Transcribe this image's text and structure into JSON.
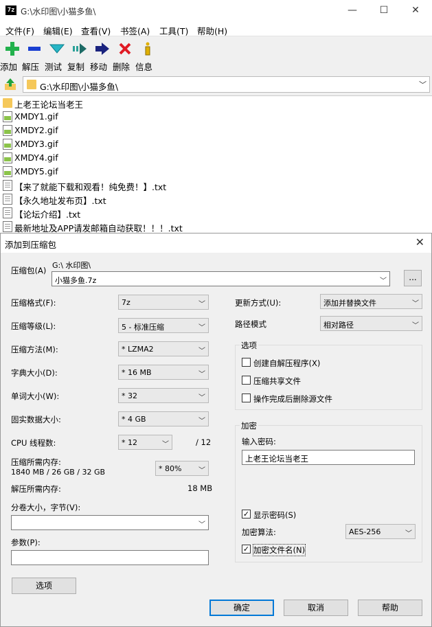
{
  "window": {
    "title": "G:\\水印图\\小猫多鱼\\",
    "app_icon_text": "7z",
    "minimize": "—",
    "maximize": "☐",
    "close": "✕"
  },
  "menu": [
    "文件(F)",
    "编辑(E)",
    "查看(V)",
    "书签(A)",
    "工具(T)",
    "帮助(H)"
  ],
  "toolbar": [
    {
      "label": "添加",
      "icon": "add-icon",
      "color": "#22b14c"
    },
    {
      "label": "解压",
      "icon": "extract-icon",
      "color": "#1a3fd1"
    },
    {
      "label": "测试",
      "icon": "test-icon",
      "color": "#27b6c6"
    },
    {
      "label": "复制",
      "icon": "copy-icon",
      "color": "#2aa198"
    },
    {
      "label": "移动",
      "icon": "move-icon",
      "color": "#1a237e"
    },
    {
      "label": "删除",
      "icon": "delete-icon",
      "color": "#e01b24"
    },
    {
      "label": "信息",
      "icon": "info-icon",
      "color": "#e0b000"
    }
  ],
  "address": {
    "path": "G:\\水印图\\小猫多鱼\\"
  },
  "files": [
    {
      "name": "上老王论坛当老王",
      "type": "folder"
    },
    {
      "name": "XMDY1.gif",
      "type": "gif"
    },
    {
      "name": "XMDY2.gif",
      "type": "gif"
    },
    {
      "name": "XMDY3.gif",
      "type": "gif"
    },
    {
      "name": "XMDY4.gif",
      "type": "gif"
    },
    {
      "name": "XMDY5.gif",
      "type": "gif"
    },
    {
      "name": "【来了就能下载和观看！纯免费！】.txt",
      "type": "txt"
    },
    {
      "name": "【永久地址发布页】.txt",
      "type": "txt"
    },
    {
      "name": "【论坛介绍】.txt",
      "type": "txt"
    },
    {
      "name": "最新地址及APP请发邮箱自动获取！！！.txt",
      "type": "txt"
    }
  ],
  "dialog": {
    "title": "添加到压缩包",
    "close": "✕",
    "archive_label": "压缩包(A)",
    "archive_folder": "G:\\ 水印图\\",
    "archive_name": "小猫多鱼.7z",
    "browse": "...",
    "format_label": "压缩格式(F):",
    "format_value": "7z",
    "level_label": "压缩等级(L):",
    "level_value": "5 - 标准压缩",
    "method_label": "压缩方法(M):",
    "method_value": "* LZMA2",
    "dict_label": "字典大小(D):",
    "dict_value": "* 16 MB",
    "word_label": "单词大小(W):",
    "word_value": "* 32",
    "solid_label": "固实数据大小:",
    "solid_value": "* 4 GB",
    "cpu_label": "CPU 线程数:",
    "cpu_value": "* 12",
    "cpu_total": "/ 12",
    "mem_label": "压缩所需内存:",
    "mem_detail": "1840 MB / 26 GB / 32 GB",
    "mem_value": "* 80%",
    "decomp_label": "解压所需内存:",
    "decomp_value": "18 MB",
    "split_label": "分卷大小，字节(V):",
    "split_value": "",
    "params_label": "参数(P):",
    "params_value": "",
    "options_button": "选项",
    "update_label": "更新方式(U):",
    "update_value": "添加并替换文件",
    "path_label": "路径模式",
    "path_value": "相对路径",
    "options_group": "选项",
    "opt_sfx": "创建自解压程序(X)",
    "opt_shared": "压缩共享文件",
    "opt_delete": "操作完成后删除源文件",
    "encrypt_group": "加密",
    "password_label": "输入密码:",
    "password_value": "上老王论坛当老王",
    "show_password": "显示密码(S)",
    "algo_label": "加密算法:",
    "algo_value": "AES-256",
    "encrypt_names": "加密文件名(N)",
    "ok": "确定",
    "cancel": "取消",
    "help": "帮助"
  }
}
